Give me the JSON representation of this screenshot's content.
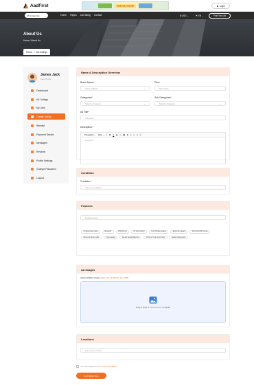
{
  "header": {
    "brand": "AadFirst",
    "login": "Login",
    "banner_text": "GRAB NOW"
  },
  "nav": {
    "category_select": "All Categories",
    "links": [
      "Home",
      "Pages",
      "Job listing",
      "Contact"
    ],
    "currency": "$ USD",
    "language": "EN",
    "post_ad": "Post Your Ad"
  },
  "hero": {
    "title": "About Us",
    "crumb_home": "Home",
    "crumb_sep": "/",
    "crumb_current": "About Us"
  },
  "tabs": {
    "home": "Home",
    "sep": ">",
    "current": "Ad Listings"
  },
  "sidebar": {
    "name": "James Jack",
    "role": "User Profile",
    "items": [
      {
        "label": "Dashboard"
      },
      {
        "label": "Ad Listings"
      },
      {
        "label": "My Jobs"
      },
      {
        "label": "Create Listing"
      },
      {
        "label": "Wishlist"
      },
      {
        "label": "Payment Details"
      },
      {
        "label": "Messages"
      },
      {
        "label": "Reviews"
      },
      {
        "label": "Profile Settings"
      },
      {
        "label": "Change Password"
      },
      {
        "label": "Logout"
      }
    ],
    "active_index": 3
  },
  "name_desc": {
    "title": "Name & Description Overview",
    "brand_label": "Brand Name*",
    "brand_value": "Select a Brand",
    "price_label": "Price",
    "price_placeholder": "Price Here",
    "category_label": "Categories*",
    "category_value": "Select a Category",
    "sub_label": "Sub Categories*",
    "sub_value": "Select a Category",
    "title_label": "Ad Title*",
    "title_placeholder": "Title Here",
    "desc_label": "Description*",
    "editor_paragraph": "Paragraph",
    "editor_size": "16px",
    "editor_placeholder": "Description"
  },
  "condition": {
    "title": "Condition",
    "label": "Condition*",
    "value": "Select a Condition"
  },
  "features": {
    "title": "Features",
    "input_placeholder": "Features Here",
    "chips": [
      "Smoking Free Inside",
      "Bluetooth",
      "Wifi/Internet",
      "All Year Parking",
      "Front Bridge Loading",
      "Electronic gauges",
      "Pets With Wifi Lounge",
      "Kitchen & Dining Table",
      "Open garage",
      "Sunset Views/Waterfront",
      "All Time Hot & Cold Chairs",
      "Heated Connectivity"
    ]
  },
  "ad_images": {
    "title": "Ad Images",
    "upload_label": "Upload Multiple Images",
    "upload_hint": "(Max Size 10 MB File Size 1MB)",
    "drop_text": "Drag & Drop or",
    "drop_link": "Choose Files",
    "drop_suffix": "to upload"
  },
  "locations": {
    "title": "Locations",
    "placeholder": "Type your Location"
  },
  "terms": {
    "text": "Yes I have agreed to the",
    "link": "Terms & Condition"
  },
  "submit": {
    "label": "Ad Publish Now"
  },
  "colors": {
    "accent": "#f26e21",
    "header_tint": "#fde9e0",
    "dark": "#2b2b2b"
  }
}
